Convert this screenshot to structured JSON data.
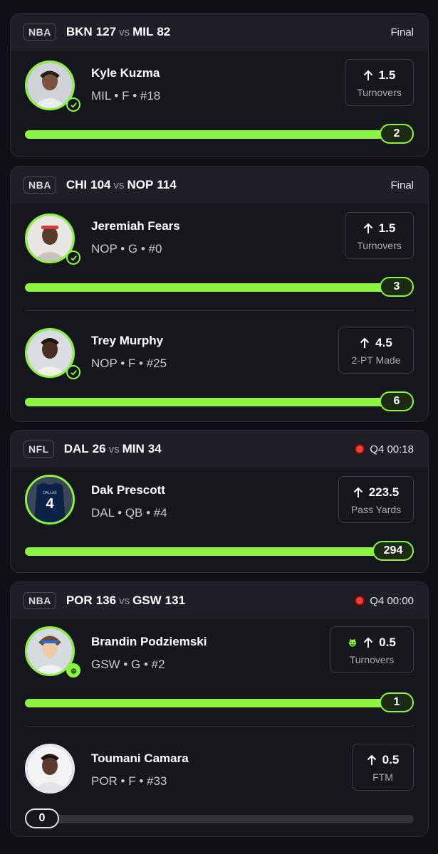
{
  "cards": [
    {
      "league": "NBA",
      "team1": "BKN",
      "score1": "127",
      "vs": "vs",
      "team2": "MIL",
      "score2": "82",
      "status": "Final",
      "players": [
        {
          "name": "Kyle Kuzma",
          "meta": "MIL • F • #18",
          "line": "1.5",
          "stat": "Turnovers",
          "result": "2",
          "progress": 1.0
        }
      ]
    },
    {
      "league": "NBA",
      "team1": "CHI",
      "score1": "104",
      "vs": "vs",
      "team2": "NOP",
      "score2": "114",
      "status": "Final",
      "players": [
        {
          "name": "Jeremiah Fears",
          "meta": "NOP • G • #0",
          "line": "1.5",
          "stat": "Turnovers",
          "result": "3",
          "progress": 1.0
        },
        {
          "name": "Trey Murphy",
          "meta": "NOP • F • #25",
          "line": "4.5",
          "stat": "2-PT Made",
          "result": "6",
          "progress": 1.0
        }
      ]
    },
    {
      "league": "NFL",
      "team1": "DAL",
      "score1": "26",
      "vs": "vs",
      "team2": "MIN",
      "score2": "34",
      "status": "Q4 00:18",
      "players": [
        {
          "name": "Dak Prescott",
          "meta": "DAL • QB • #4",
          "line": "223.5",
          "stat": "Pass Yards",
          "result": "294",
          "progress": 1.0,
          "jersey_number": "4",
          "jersey_text": "DALLAS"
        }
      ]
    },
    {
      "league": "NBA",
      "team1": "POR",
      "score1": "136",
      "vs": "vs",
      "team2": "GSW",
      "score2": "131",
      "status": "Q4 00:00",
      "players": [
        {
          "name": "Brandin Podziemski",
          "meta": "GSW • G • #2",
          "line": "0.5",
          "stat": "Turnovers",
          "result": "1",
          "progress": 1.0
        },
        {
          "name": "Toumani Camara",
          "meta": "POR • F • #33",
          "line": "0.5",
          "stat": "FTM",
          "result": "0",
          "progress": 0.0
        }
      ]
    }
  ],
  "colors": {
    "accent": "#8cf542",
    "live": "#ff3b3b",
    "background": "#0f1015",
    "card": "#16171d"
  }
}
